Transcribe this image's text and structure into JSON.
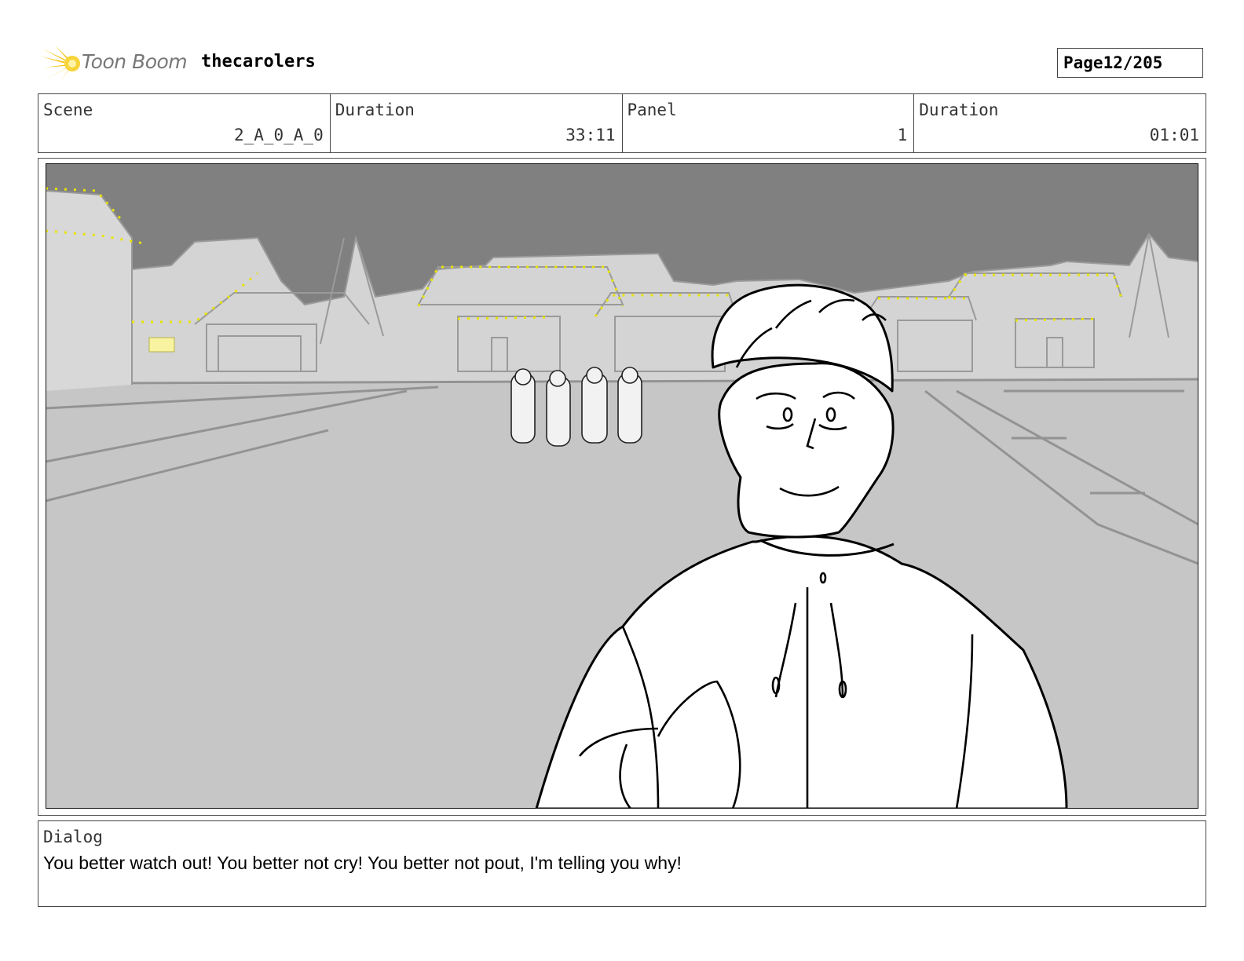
{
  "header": {
    "brand_logo_text": "Toon Boom",
    "project_name": "thecarolers",
    "page_label": "Page",
    "page_value": "12/205"
  },
  "info": {
    "scene_label": "Scene",
    "scene_value": "2_A_0_A_0",
    "scene_duration_label": "Duration",
    "scene_duration_value": "33:11",
    "panel_label": "Panel",
    "panel_value": "1",
    "panel_duration_label": "Duration",
    "panel_duration_value": "01:01"
  },
  "dialog": {
    "label": "Dialog",
    "text": "You better watch out! You better not cry! You better not pout, I'm telling you why!"
  },
  "colors": {
    "accent_yellow": "#f5d21f",
    "sky": "#808080",
    "ground": "#c8c8c8",
    "buildings": "#d4d4d4"
  }
}
